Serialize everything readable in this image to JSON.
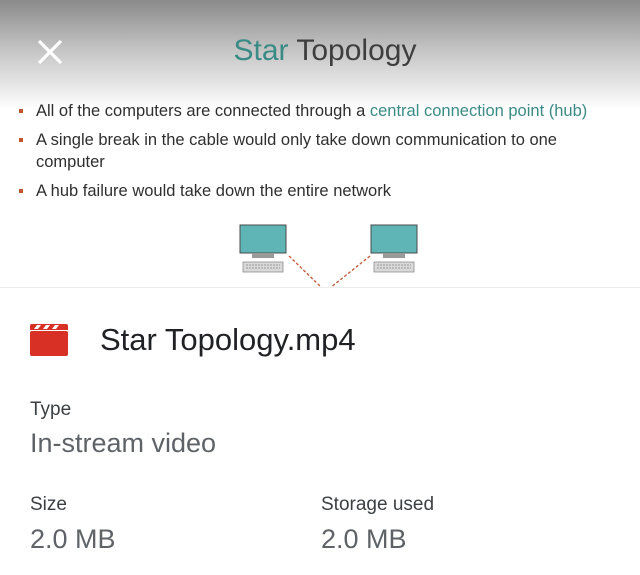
{
  "preview": {
    "title_part1": "Star",
    "title_part2": " Topology",
    "bullets": [
      {
        "pre": "All of the computers are connected through a ",
        "link": "central connection point (hub)"
      },
      {
        "pre": "A single break in the cable would only take down communication to one computer",
        "link": ""
      },
      {
        "pre": "A hub failure would take down the entire network",
        "link": ""
      }
    ],
    "colors": {
      "accent": "#3a8a86",
      "bullet": "#c2552e",
      "monitor": "#5fb5b6"
    }
  },
  "file": {
    "name": "Star Topology.mp4",
    "icon": "video-file-icon",
    "icon_color": "#d93025"
  },
  "details": {
    "type_label": "Type",
    "type_value": "In-stream video",
    "size_label": "Size",
    "size_value": "2.0 MB",
    "storage_label": "Storage used",
    "storage_value": "2.0 MB"
  },
  "controls": {
    "close_icon": "close-icon"
  }
}
